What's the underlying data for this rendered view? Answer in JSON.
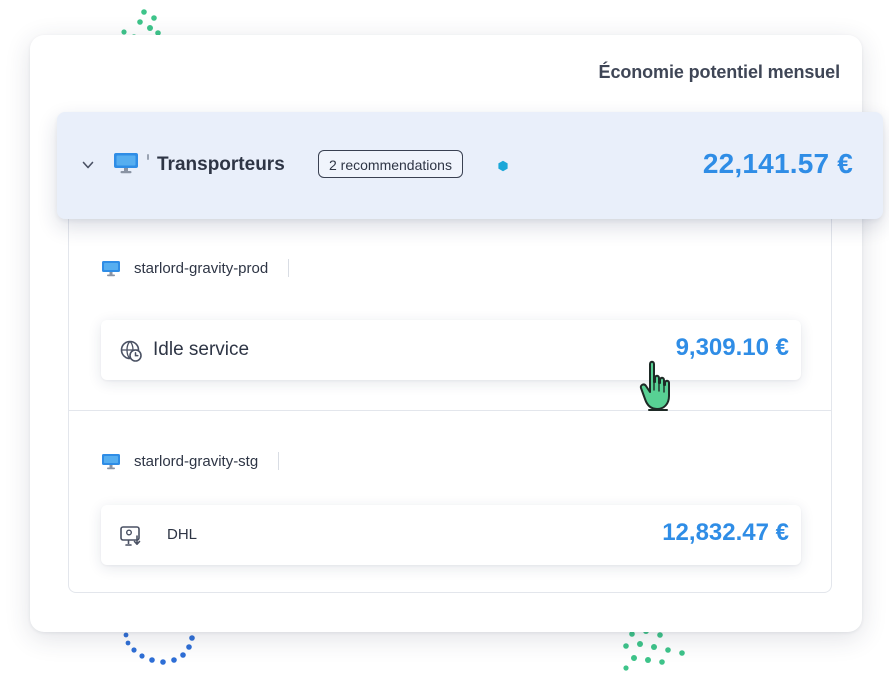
{
  "header": {
    "title": "Économie potentiel mensuel"
  },
  "group": {
    "title": "Transporteurs",
    "badge": "2 recommendations",
    "amount": "22,141.57 €",
    "expanded": true
  },
  "resources": [
    {
      "name": "starlord-gravity-prod",
      "recommendation": {
        "label": "Idle service",
        "amount": "9,309.10 €",
        "icon": "globe-clock-icon"
      }
    },
    {
      "name": "starlord-gravity-stg",
      "recommendation": {
        "label": "DHL",
        "amount": "12,832.47 €",
        "icon": "download-screen-icon"
      }
    }
  ],
  "colors": {
    "accent": "#2f8de6",
    "highlight": "#e9effa",
    "dot_green": "#3ec48a",
    "dot_blue": "#2f6fd6",
    "hex_dot": "#1aa7d8",
    "cursor": "#58d194"
  }
}
